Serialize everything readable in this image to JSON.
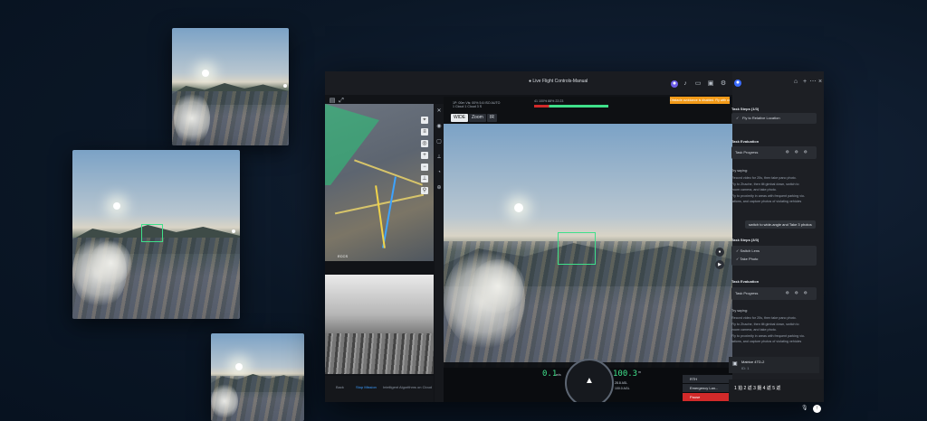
{
  "window": {
    "title": "● Live Flight Controls-Manual"
  },
  "topbar": {
    "telemetry_line1": "1P: 00m  Vis: 00% 5.6  ISO  AUTO",
    "telemetry_line2": "1 Cloud  1 Cloud  3  S",
    "status_strip": "41  100%  88%  22:23",
    "alert": "Obstacle avoidance is disabled. Fly with caution.",
    "modes": [
      "WIDE",
      "Zoom",
      "IR"
    ]
  },
  "map": {
    "label": "ECCS"
  },
  "bottom_tabs": [
    "Back",
    "Stop Mission",
    "Intelligent Algorithms on Cloud"
  ],
  "hud": {
    "left_speed": "0.1",
    "left_unit": "m/s",
    "right_alt": "100.3",
    "right_unit": "m",
    "sub1": "28.8 ASL",
    "sub2": "100.0 AGL",
    "rth_label": "RTH",
    "emergency_label": "Emergency Lan...",
    "pause_label": "Pause",
    "battery": "98%"
  },
  "panel": {
    "header": "Task Steps (1/3)",
    "step1": "Fly to Relative Location",
    "eval1_title": "Task Evaluation",
    "eval1_item": "Task Progress",
    "tip1_title": "Try saying:",
    "tip1_lines": [
      "Record video for 20s, then take pano photo.",
      "Fly to Zhaohe, then tilt gimbal down, switch to",
      "zoom camera, and take photo.",
      "Fly to proximity in areas with frequent parking vio-",
      "lations, and capture photos of violating vehicles"
    ],
    "chip": "switch to wide-angle and Take 3 photos",
    "steps2_header": "Task Steps (3/3)",
    "steps2_items": [
      "Switch Lens",
      "Take Photo"
    ],
    "eval2_title": "Task Evaluation",
    "eval2_item": "Task Progress",
    "tip2_title": "Try saying:",
    "tip2_lines": [
      "Record video for 20s, then take pano photo.",
      "Fly to Zhaohe, then tilt gimbal down, switch to",
      "zoom camera, and take photo.",
      "Fly to proximity in areas with frequent parking vio-",
      "lations, and capture photos of violating vehicles"
    ],
    "drone_name": "Matrice 4TD-2",
    "drone_sub": "ID: 1",
    "input_steps": "1 拍  2 返  3 摄  4 返  5 返"
  },
  "colors": {
    "accent": "#3fe08a",
    "alert": "#f29a18",
    "pause": "#d22a2a",
    "link": "#3b9cff"
  }
}
